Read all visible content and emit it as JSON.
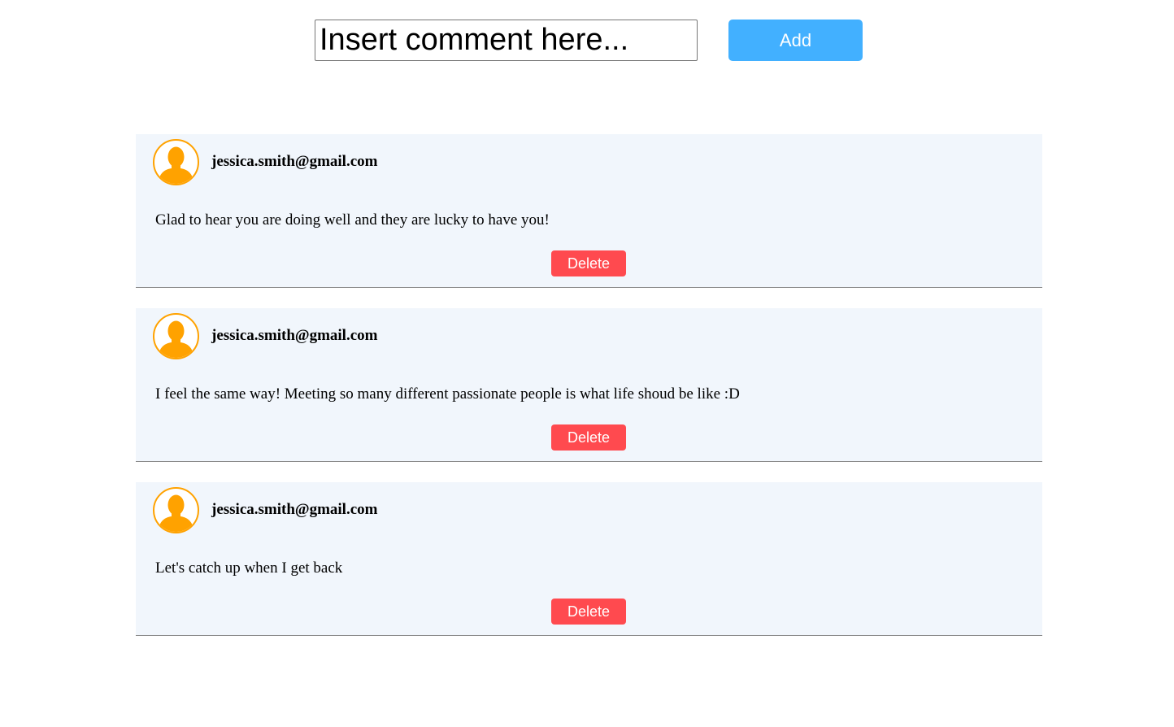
{
  "composer": {
    "placeholder": "Insert comment here...",
    "add_label": "Add"
  },
  "colors": {
    "add_button": "#42b0ff",
    "delete_button": "#ff4a4f",
    "avatar": "#ffa200",
    "card_background": "#f1f6fc"
  },
  "comments": [
    {
      "author": "jessica.smith@gmail.com",
      "text": "Glad to hear you are doing well and they are lucky to have you!",
      "delete_label": "Delete",
      "avatar_icon": "user-silhouette-icon"
    },
    {
      "author": "jessica.smith@gmail.com",
      "text": "I feel the same way! Meeting so many different passionate people is what life shoud be like :D",
      "delete_label": "Delete",
      "avatar_icon": "user-silhouette-icon"
    },
    {
      "author": "jessica.smith@gmail.com",
      "text": "Let's catch up when I get back",
      "delete_label": "Delete",
      "avatar_icon": "user-silhouette-icon"
    }
  ]
}
